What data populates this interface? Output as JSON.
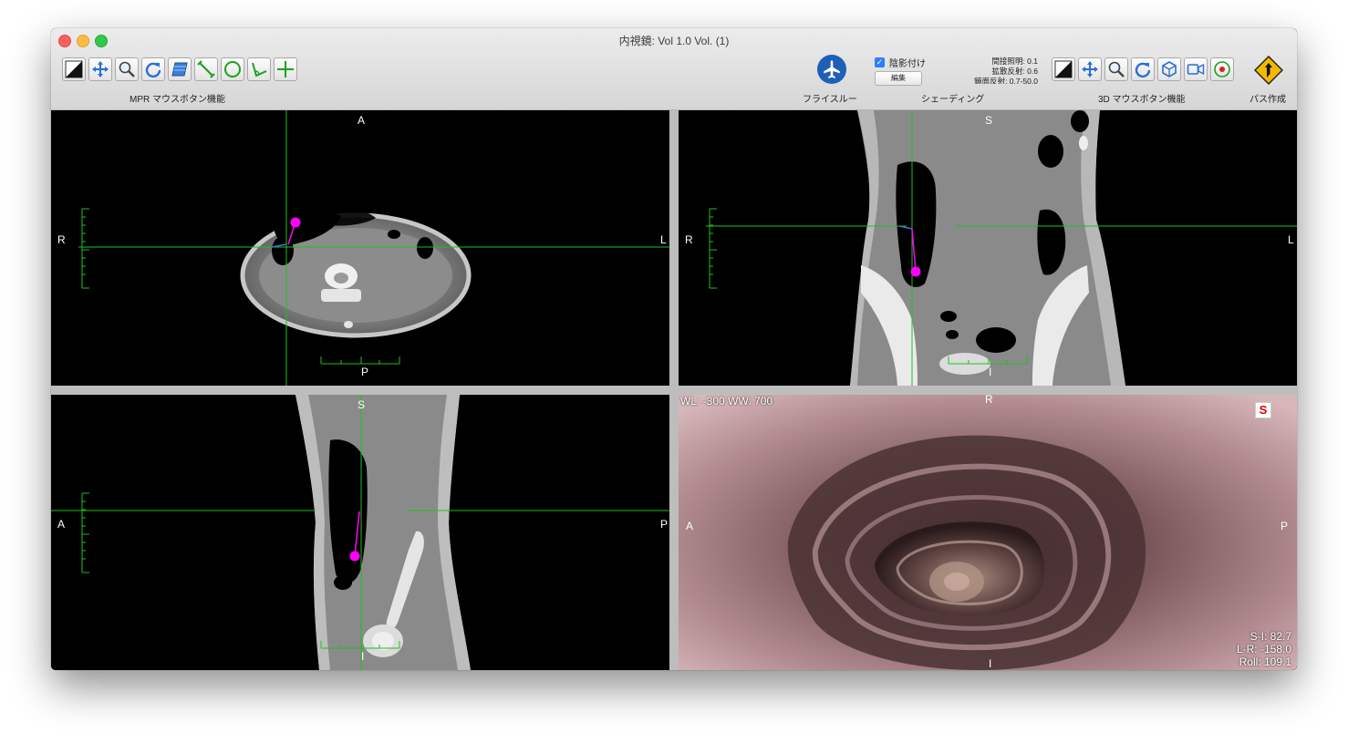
{
  "window": {
    "title": "内視鏡:  Vol 1.0 Vol. (1)"
  },
  "toolbar": {
    "mpr_group_label": "MPR マウスボタン機能",
    "flythrough_label": "フライスルー",
    "shading_checkbox_label": "陰影付け",
    "edit_button": "編集",
    "shading_label": "シェーディング",
    "params": [
      "間接照明: 0.1",
      "拡散反射: 0.6",
      "鏡面反射: 0.7-50.0"
    ],
    "d3_group_label": "3D マウスボタン機能",
    "path_label": "パス作成",
    "mpr_tools": [
      "window-level-icon",
      "move-icon",
      "zoom-icon",
      "rotate-icon",
      "slab-icon",
      "line-measure-icon",
      "ellipse-roi-icon",
      "angle-icon",
      "crosshair-icon"
    ],
    "d3_tools": [
      "window-level-icon",
      "move-icon",
      "zoom-icon",
      "rotate-icon",
      "cube-orientation-icon",
      "camera-icon",
      "target-icon"
    ]
  },
  "viewports": {
    "axial": {
      "top": "A",
      "bottom": "P",
      "left": "R",
      "right": "L"
    },
    "coronal": {
      "top": "S",
      "bottom": "I",
      "left": "R",
      "right": "L"
    },
    "sagittal": {
      "top": "S",
      "bottom": "I",
      "left": "A",
      "right": "P"
    },
    "endoscopic": {
      "top": "R",
      "bottom": "I",
      "left": "A",
      "right": "P",
      "wlww": "WL: -300 WW: 700",
      "badge": "S",
      "si": "S-I: 82.7",
      "lr": "L-R: -158.0",
      "roll": "Roll: 109.1"
    }
  },
  "colors": {
    "crosshair": "#1ec01e",
    "marker": "#ff00ff",
    "plane": "#1f5fb7"
  }
}
